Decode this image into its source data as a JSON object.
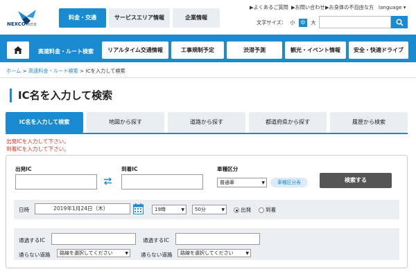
{
  "logo": {
    "brand": "NEXCO",
    "sub": "西日本"
  },
  "main_tabs": [
    "料金・交通",
    "サービスエリア情報",
    "企業情報"
  ],
  "utility_links": [
    "よくあるご質問",
    "お問い合わせ",
    "お身体の不自由な方",
    "language"
  ],
  "font_size": {
    "label": "文字サイズ：",
    "options": [
      "小",
      "中",
      "大"
    ],
    "active": "中"
  },
  "search": {
    "placeholder": ""
  },
  "nav": [
    "高速料金・ルート検索",
    "リアルタイム交通情報",
    "工事規制予定",
    "渋滞予測",
    "観光・イベント情報",
    "安全・快適ドライブ"
  ],
  "breadcrumb": {
    "home": "ホーム",
    "sep": ">",
    "section": "高速料金・ルート検索",
    "current": "ICを入力して検索"
  },
  "page_title": "IC名を入力して検索",
  "sub_tabs": [
    "IC名を入力して検索",
    "地図から探す",
    "道路から探す",
    "都道府県から探す",
    "履歴から検索"
  ],
  "errors": [
    "出発ICを入力して下さい。",
    "到着ICを入力して下さい。"
  ],
  "form": {
    "from_label": "出発IC",
    "to_label": "到着IC",
    "vehicle_label": "車種区分",
    "vehicle_value": "普通車",
    "vehicle_table": "車種区分表",
    "submit": "検索する",
    "datetime_label": "日時",
    "date_value": "2019年1月24日（木）",
    "hour_value": "19時",
    "minute_value": "50分",
    "depart": "出発",
    "arrive": "到着",
    "via_label": "通過するIC",
    "avoid_label": "通らない道路",
    "avoid_select": "路線を選択してください"
  },
  "colors": {
    "accent": "#1a8bd1",
    "error": "#e03020"
  }
}
